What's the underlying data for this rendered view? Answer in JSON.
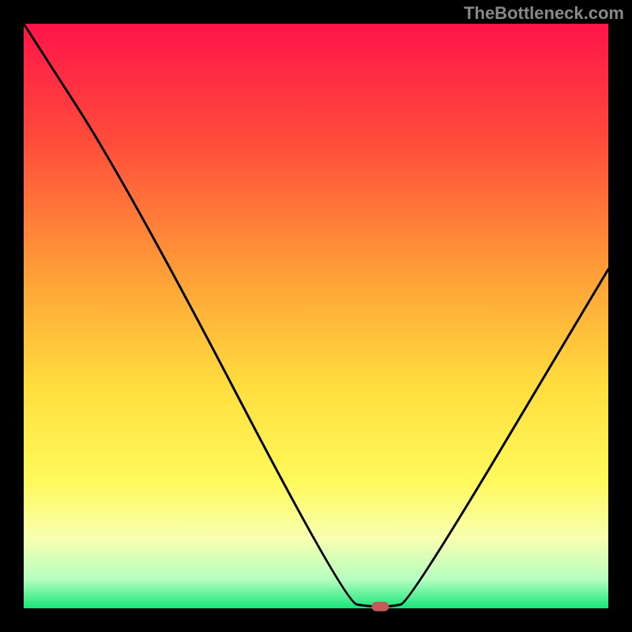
{
  "watermark": "TheBottleneck.com",
  "chart_data": {
    "type": "line",
    "title": "",
    "xlabel": "",
    "ylabel": "",
    "xlim": [
      0,
      100
    ],
    "ylim": [
      0,
      100
    ],
    "series": [
      {
        "name": "bottleneck-curve",
        "x": [
          0,
          18,
          55,
          59,
          63,
          66,
          100
        ],
        "values": [
          100,
          72,
          1,
          0.3,
          0.3,
          1,
          58
        ]
      }
    ],
    "optimum_marker": {
      "x": 61,
      "y": 0.3
    },
    "background": {
      "type": "vertical-gradient",
      "stops": [
        {
          "pos": 0.0,
          "color": "#ff144a"
        },
        {
          "pos": 0.2,
          "color": "#ff4c3a"
        },
        {
          "pos": 0.45,
          "color": "#ffa638"
        },
        {
          "pos": 0.62,
          "color": "#ffde3e"
        },
        {
          "pos": 0.78,
          "color": "#fff95a"
        },
        {
          "pos": 0.88,
          "color": "#f8ffb0"
        },
        {
          "pos": 0.95,
          "color": "#b6ffc0"
        },
        {
          "pos": 1.0,
          "color": "#17e57a"
        }
      ]
    },
    "border_px": 30,
    "marker_color": "#c35a5a"
  }
}
